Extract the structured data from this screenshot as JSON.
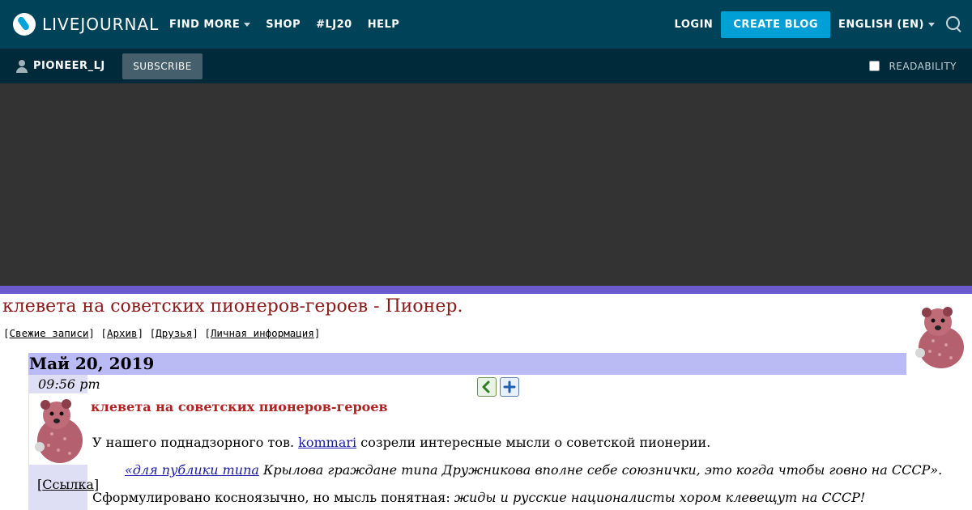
{
  "topbar": {
    "logo_text": "LIVEJOURNAL",
    "nav": [
      "FIND MORE",
      "SHOP",
      "#LJ20",
      "HELP"
    ],
    "login": "LOGIN",
    "create_blog": "CREATE BLOG",
    "language": "ENGLISH (EN)"
  },
  "subbar": {
    "username": "PIONEER_LJ",
    "subscribe": "SUBSCRIBE",
    "readability": "READABILITY"
  },
  "journal": {
    "title": "клевета на советских пионеров-героев - Пионер.",
    "links": [
      "Свежие записи",
      "Архив",
      "Друзья",
      "Личная информация"
    ]
  },
  "entry": {
    "date": "Май 20, 2019",
    "time": "09:56 pm",
    "link_label": "Ссылка",
    "subject": "клевета на советских пионеров-героев",
    "p1_before": "У нашего поднадзорного тов. ",
    "p1_user": "kommari",
    "p1_after": " созрели интересные мысли о советской пионерии.",
    "q_link": "«для публики типа",
    "q_rest": " Крылова граждане типа Дружникова вполне себе союзнички, это когда чтобы говно на СССР».",
    "p3_before": "Сформулировано косноязычно, но мысль понятная: ",
    "p3_em": "жиды и русские националисты хором клевещут на СССР!"
  },
  "colors": {
    "topbar": "#004359",
    "subbar": "#00293a",
    "accent": "#00a0d6",
    "date_bar": "#babaf5",
    "title": "#8b1a1a"
  }
}
